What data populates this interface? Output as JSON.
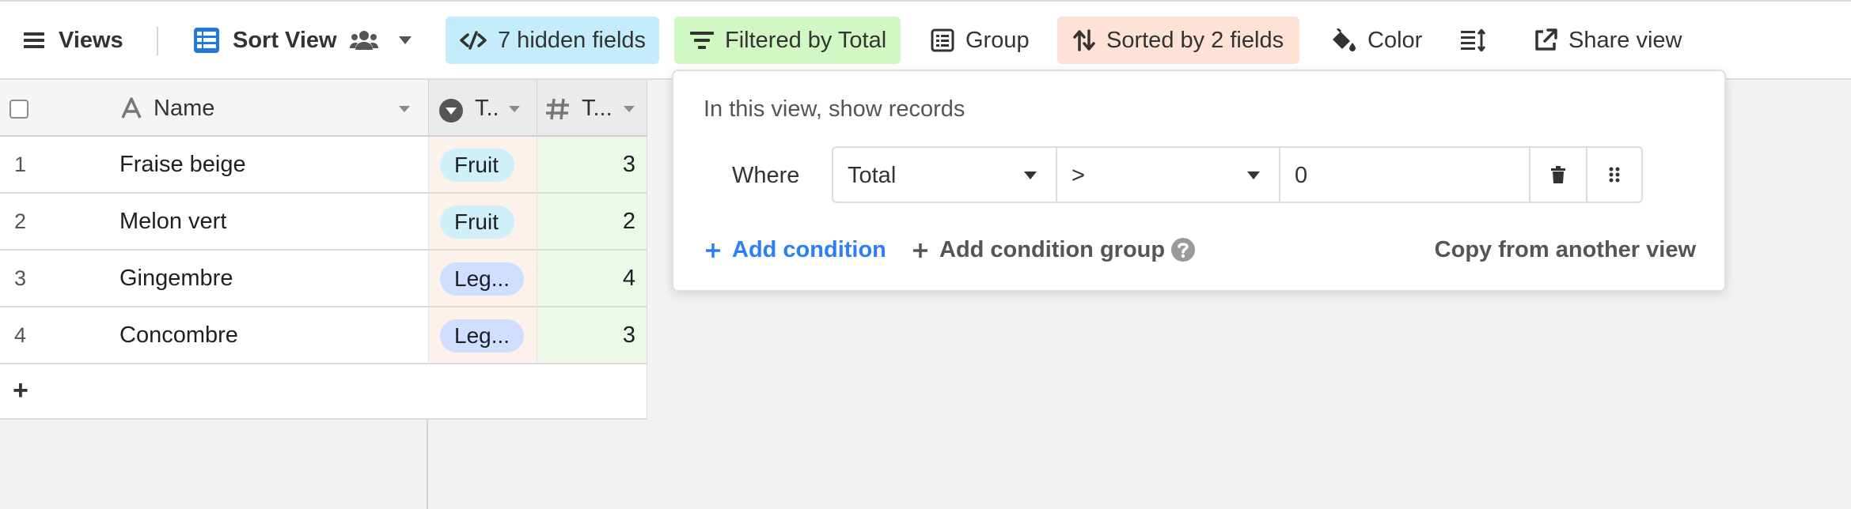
{
  "toolbar": {
    "views_label": "Views",
    "view_name": "Sort View",
    "hidden_fields": "7 hidden fields",
    "filter": "Filtered by Total",
    "group": "Group",
    "sort": "Sorted by 2 fields",
    "color": "Color",
    "share": "Share view",
    "colors": {
      "hidden": "#c4ecfb",
      "filter": "#d1f7c4",
      "sort": "#fee2d5",
      "accent": "#2d7ff9"
    }
  },
  "grid": {
    "columns": [
      {
        "label": "Name",
        "icon": "text-field-icon"
      },
      {
        "label": "T..",
        "icon": "single-select-icon"
      },
      {
        "label": "T...",
        "icon": "number-field-icon"
      }
    ],
    "rows": [
      {
        "num": "1",
        "name": "Fraise beige",
        "type": "Fruit",
        "total": "3"
      },
      {
        "num": "2",
        "name": "Melon vert",
        "type": "Fruit",
        "total": "2"
      },
      {
        "num": "3",
        "name": "Gingembre",
        "type": "Leg...",
        "total": "4"
      },
      {
        "num": "4",
        "name": "Concombre",
        "type": "Leg...",
        "total": "3"
      }
    ],
    "add_row": "+"
  },
  "filter_popover": {
    "title": "In this view, show records",
    "condition": {
      "where": "Where",
      "field": "Total",
      "operator": ">",
      "value": "0"
    },
    "add_condition": "Add condition",
    "add_condition_group": "Add condition group",
    "copy_from_view": "Copy from another view"
  }
}
